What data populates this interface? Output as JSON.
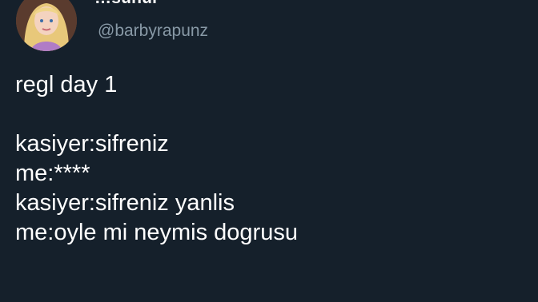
{
  "tweet": {
    "author": {
      "display_name": "…sunur",
      "handle": "@barbyrapunz",
      "avatar_icon": "avatar-icon"
    },
    "text_lines": [
      "regl day 1",
      "",
      "kasiyer:sifreniz",
      "me:****",
      "kasiyer:sifreniz yanlis",
      "me:oyle mi neymis dogrusu"
    ]
  },
  "colors": {
    "background": "#15202b",
    "text": "#ffffff",
    "handle": "#8899a6"
  }
}
